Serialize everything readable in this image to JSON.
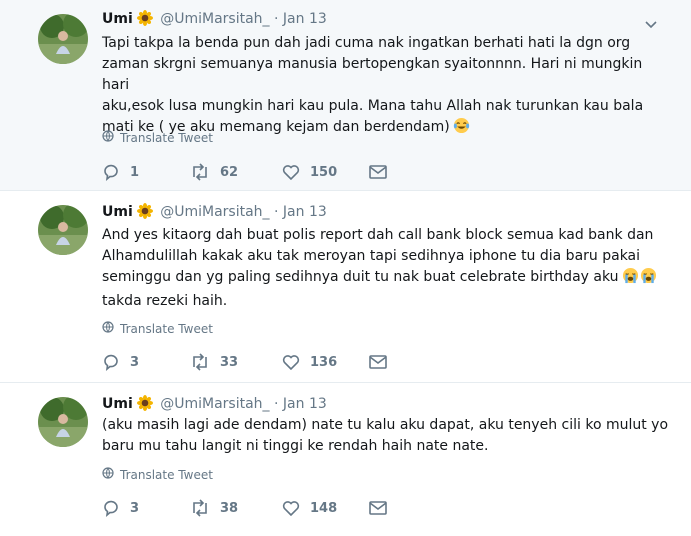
{
  "colors": {
    "thread_line": "#ccd6dd",
    "text": "#14171a",
    "secondary": "#657786",
    "highlight_bg": "#f5f8fa"
  },
  "tweets": [
    {
      "name": "Umi",
      "handle": "@UmiMarsitah_",
      "separator": "·",
      "date": "Jan 13",
      "lines": [
        "Tapi takpa la benda pun dah jadi cuma nak ingatkan berhati hati la dgn org",
        "zaman skrgni semuanya manusia bertopengkan syaitonnnn. Hari ni mungkin hari",
        "aku,esok lusa mungkin hari kau pula. Mana tahu Allah nak turunkan kau bala",
        "mati ke ( ye aku memang kejam dan berdendam)"
      ],
      "translate": "Translate Tweet",
      "replies": "1",
      "retweets": "62",
      "likes": "150",
      "emoji": "laughing-crying"
    },
    {
      "name": "Umi",
      "handle": "@UmiMarsitah_",
      "separator": "·",
      "date": "Jan 13",
      "lines": [
        "And yes kitaorg dah buat polis report dah call bank block semua kad bank dan",
        "Alhamdulillah kakak aku tak meroyan tapi sedihnya iphone tu dia baru pakai",
        "seminggu dan yg paling sedihnya duit tu nak buat celebrate birthday aku",
        "takda rezeki haih."
      ],
      "translate": "Translate Tweet",
      "replies": "3",
      "retweets": "33",
      "likes": "136",
      "emoji": "loudly-crying"
    },
    {
      "name": "Umi",
      "handle": "@UmiMarsitah_",
      "separator": "·",
      "date": "Jan 13",
      "lines": [
        "(aku masih lagi ade dendam)  nate tu kalu aku dapat, aku tenyeh cili ko mulut yo",
        "baru mu tahu langit ni tinggi ke rendah haih nate nate."
      ],
      "translate": "Translate Tweet",
      "replies": "3",
      "retweets": "38",
      "likes": "148"
    }
  ]
}
